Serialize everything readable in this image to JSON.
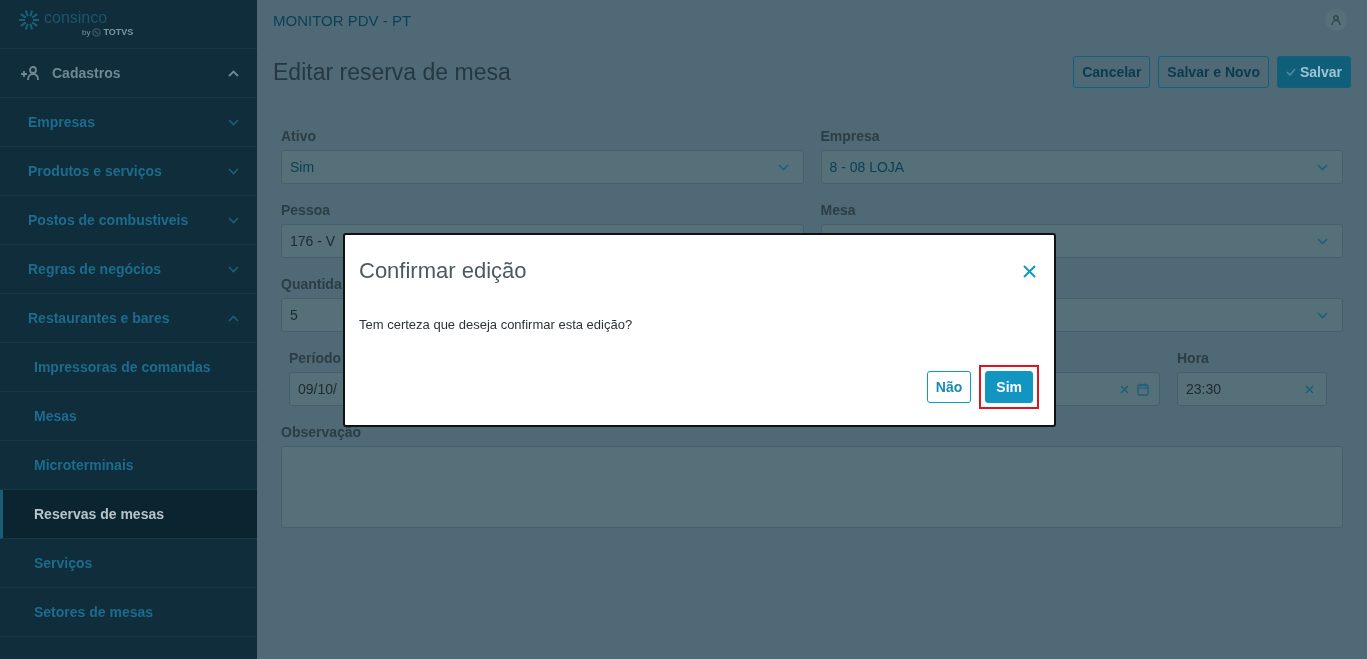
{
  "logo": {
    "name": "consinco",
    "by": "by",
    "brand": "TOTVS"
  },
  "sidebar": {
    "section": {
      "label": "Cadastros",
      "expanded": true
    },
    "items": [
      {
        "label": "Empresas",
        "expanded": false
      },
      {
        "label": "Produtos e serviços",
        "expanded": false
      },
      {
        "label": "Postos de combustiveis",
        "expanded": false
      },
      {
        "label": "Regras de negócios",
        "expanded": false
      },
      {
        "label": "Restaurantes e bares",
        "expanded": true,
        "children": [
          {
            "label": "Impressoras de comandas",
            "selected": false
          },
          {
            "label": "Mesas",
            "selected": false
          },
          {
            "label": "Microterminais",
            "selected": false
          },
          {
            "label": "Reservas de mesas",
            "selected": true
          },
          {
            "label": "Serviços",
            "selected": false
          },
          {
            "label": "Setores de mesas",
            "selected": false
          }
        ]
      }
    ]
  },
  "header": {
    "title": "MONITOR PDV - PT"
  },
  "page": {
    "title": "Editar reserva de mesa",
    "actions": [
      {
        "label": "Cancelar",
        "kind": "outline"
      },
      {
        "label": "Salvar e Novo",
        "kind": "outline"
      },
      {
        "label": "Salvar",
        "kind": "primary"
      }
    ]
  },
  "form": {
    "fields": [
      {
        "label": "Ativo",
        "value": "Sim",
        "kind": "select"
      },
      {
        "label": "Empresa",
        "value": "8 - 08 LOJA",
        "kind": "select"
      },
      {
        "label": "Pessoa",
        "value": "176 - V",
        "kind": "text"
      },
      {
        "label": "Mesa",
        "kind": "select"
      },
      {
        "label": "Quantida",
        "value": "5",
        "kind": "text"
      },
      {
        "kind": "select"
      }
    ],
    "period": {
      "label": "Período",
      "start": "09/10/"
    },
    "time": {
      "label": "Hora",
      "value": "23:30"
    },
    "notes": {
      "label": "Observação"
    }
  },
  "modal": {
    "title": "Confirmar edição",
    "message": "Tem certeza que deseja confirmar esta edição?",
    "buttons": [
      {
        "label": "Não",
        "kind": "outline",
        "highlighted": false
      },
      {
        "label": "Sim",
        "kind": "primary",
        "highlighted": true
      }
    ]
  }
}
